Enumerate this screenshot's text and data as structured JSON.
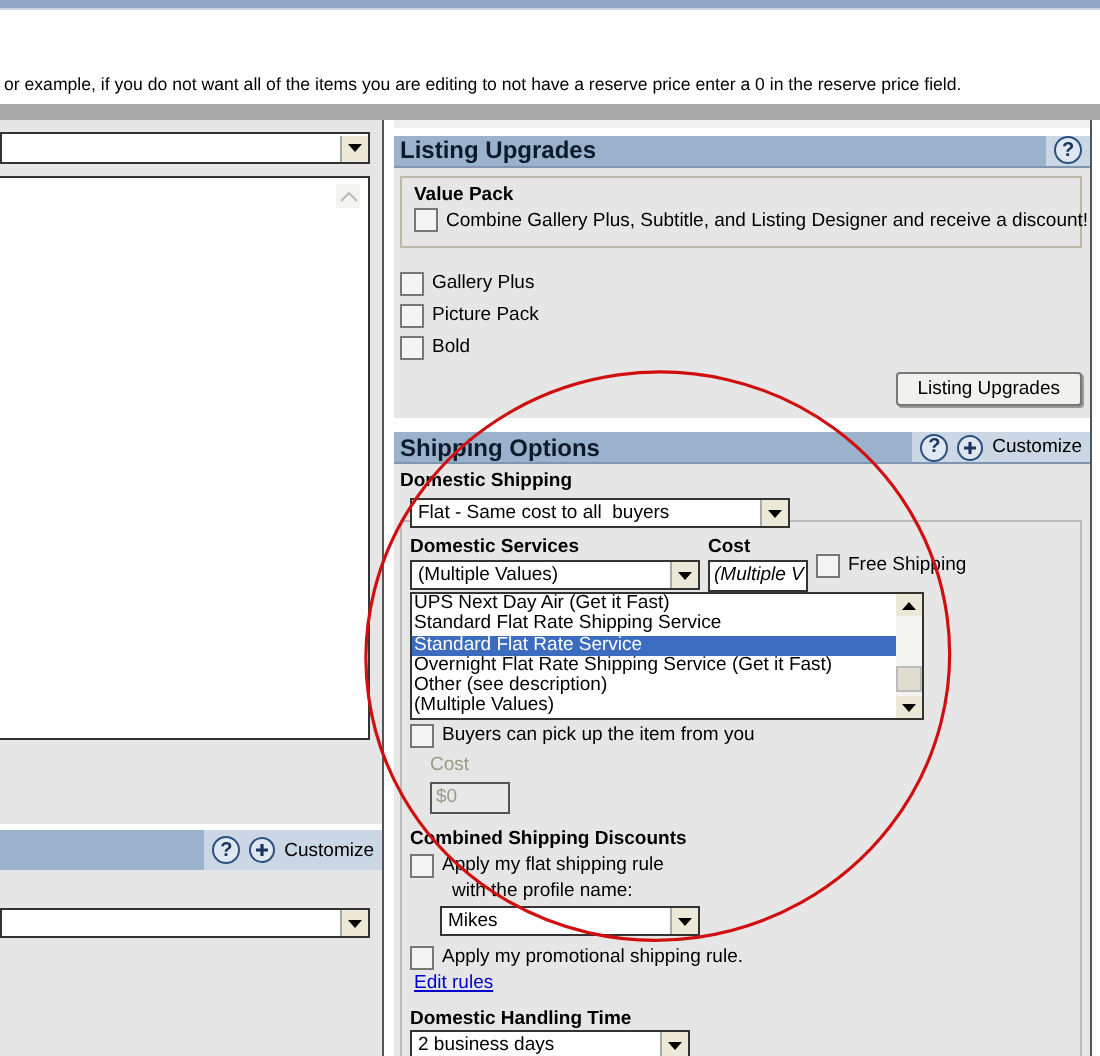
{
  "instruction": "or example, if you do not want all of the items you are editing to not have a reserve price enter a 0 in the reserve price field.",
  "left_section": {
    "help": "?",
    "customize": "Customize"
  },
  "listing_upgrades": {
    "title": "Listing Upgrades",
    "help": "?",
    "value_pack": {
      "title": "Value Pack",
      "option": {
        "label": "Combine Gallery Plus, Subtitle, and Listing Designer and receive a discount!",
        "checked": false
      }
    },
    "options": [
      {
        "label": "Gallery Plus",
        "checked": false
      },
      {
        "label": "Picture Pack",
        "checked": false
      },
      {
        "label": "Bold",
        "checked": false
      }
    ],
    "button": "Listing Upgrades"
  },
  "shipping_options": {
    "title": "Shipping Options",
    "help": "?",
    "customize": "Customize",
    "domestic_shipping_label": "Domestic Shipping",
    "shipping_type": "Flat - Same cost to all  buyers",
    "services_label": "Domestic Services",
    "cost_label": "Cost",
    "service_value": "(Multiple Values)",
    "cost_value": "(Multiple V",
    "free_shipping": {
      "label": "Free Shipping",
      "checked": false
    },
    "service_list": [
      {
        "label": "UPS Next Day Air (Get it Fast)",
        "selected": false
      },
      {
        "label": "Standard Flat Rate Shipping Service",
        "selected": false
      },
      {
        "label": "Standard Flat Rate Service",
        "selected": true
      },
      {
        "label": "Overnight Flat Rate Shipping Service (Get it Fast)",
        "selected": false
      },
      {
        "label": "Other (see description)",
        "selected": false
      },
      {
        "label": "(Multiple Values)",
        "selected": false
      }
    ],
    "pickup": {
      "label": "Buyers can pick up the item from you",
      "checked": false
    },
    "pickup_cost": {
      "label": "Cost",
      "value": "$0",
      "disabled": true
    },
    "combined_label": "Combined Shipping Discounts",
    "flat_rule": {
      "label": "Apply my flat shipping rule",
      "checked": false
    },
    "profile_label": "with the profile name:",
    "profile_value": "Mikes",
    "promo_rule": {
      "label": "Apply my promotional shipping rule.",
      "checked": false
    },
    "edit_rules": "Edit rules",
    "handling_label": "Domestic Handling Time",
    "handling_value": "2 business days"
  }
}
